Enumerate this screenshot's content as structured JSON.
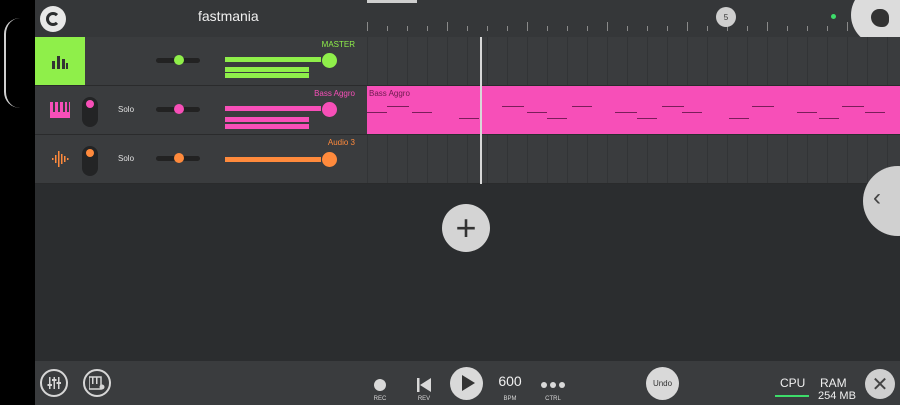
{
  "project": {
    "title": "fastmania"
  },
  "timeline": {
    "marker_label": "5"
  },
  "tracks": [
    {
      "name": "MASTER",
      "color": "#8fef4a",
      "type": "master",
      "icon": "mixer-bars-icon"
    },
    {
      "name": "Bass Aggro",
      "color": "#f74fb8",
      "type": "synth",
      "icon": "piano-keys-icon",
      "solo_label": "Solo"
    },
    {
      "name": "Audio 3",
      "color": "#ff8a3c",
      "type": "audio",
      "icon": "waveform-icon",
      "solo_label": "Solo"
    }
  ],
  "clip": {
    "label": "Bass Aggro"
  },
  "transport": {
    "rec_label": "REC",
    "rev_label": "REV",
    "bpm_value": "600",
    "bpm_label": "BPM",
    "ctrl_label": "CTRL",
    "undo_label": "Undo"
  },
  "status": {
    "cpu_label": "CPU",
    "ram_label": "RAM",
    "ram_value": "254 MB"
  },
  "icons": {
    "add_track": "plus-icon",
    "close": "close-icon",
    "side": "chevron-left-icon"
  }
}
